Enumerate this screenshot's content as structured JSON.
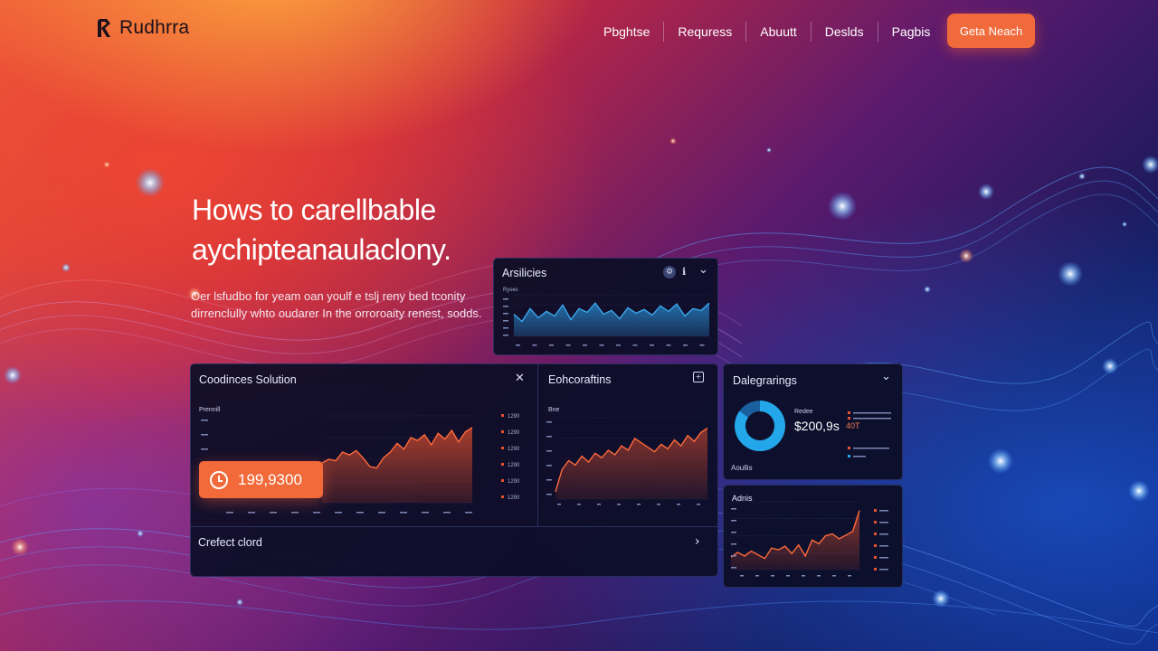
{
  "brand": {
    "name": "Rudhrra"
  },
  "nav": {
    "links": [
      "Pbghtse",
      "Requress",
      "Abuutt",
      "Deslds",
      "Pagbis"
    ],
    "cta": "Geta Neach"
  },
  "hero": {
    "title": "Hows to carellbable aychipteanaulaclony.",
    "subtitle": "Oer lsfudbo for yeam oan youlf e tslj reny bed tconity dirrenclully whto oudarer In the orroroaity renest, sodds."
  },
  "panels": {
    "analytics": {
      "title": "Arsilicies",
      "axis_label": "Ryses"
    },
    "solution": {
      "title": "Coodinces Solution",
      "axis_label": "Prennill",
      "metric": "199,9300",
      "legend": [
        "1290",
        "1290",
        "1290",
        "1290",
        "1290",
        "1290"
      ]
    },
    "conversions": {
      "title": "Eohcoraftins",
      "axis_label": "Bne"
    },
    "dalegrarings": {
      "title": "Dalegrarings",
      "label": "Redee",
      "value": "$200,9s",
      "delta": "40T",
      "sub": "Aoullis"
    },
    "admin": {
      "title": "Adnis"
    },
    "footer": {
      "label": "Crefect clord"
    }
  },
  "colors": {
    "accent": "#f06a3c",
    "chart_orange": "#e9522e",
    "chart_blue": "#2a8fd6",
    "panel_bg": "#0c0e26"
  },
  "chart_data": [
    {
      "type": "area",
      "title": "Arsilicies",
      "series": [
        {
          "values": [
            24,
            16,
            30,
            20,
            27,
            22,
            34,
            18,
            30,
            26,
            36,
            24,
            28,
            19,
            31,
            25,
            29,
            23,
            33,
            27,
            35,
            22,
            30,
            28,
            36
          ]
        }
      ],
      "ylim": [
        0,
        45
      ]
    },
    {
      "type": "area",
      "title": "Coodinces Solution",
      "series": [
        {
          "values": [
            55,
            60,
            58,
            70,
            66,
            72,
            62,
            50,
            48,
            62,
            70,
            82,
            74,
            90,
            86,
            94,
            80,
            96,
            88,
            100,
            84,
            98,
            104
          ]
        }
      ],
      "ylim": [
        0,
        120
      ]
    },
    {
      "type": "area",
      "title": "Eohcoraftins",
      "series": [
        {
          "values": [
            10,
            40,
            52,
            46,
            58,
            50,
            62,
            56,
            66,
            60,
            72,
            66,
            82,
            76,
            70,
            64,
            74,
            68,
            80,
            72,
            86,
            78,
            90,
            96
          ]
        }
      ],
      "ylim": [
        0,
        110
      ]
    },
    {
      "type": "pie",
      "title": "Dalegrarings",
      "values": [
        85,
        15
      ]
    },
    {
      "type": "area",
      "title": "Adnis",
      "series": [
        {
          "values": [
            20,
            28,
            22,
            30,
            24,
            18,
            35,
            32,
            38,
            26,
            40,
            22,
            48,
            42,
            55,
            58,
            50,
            56,
            62,
            96
          ]
        }
      ],
      "ylim": [
        0,
        110
      ]
    }
  ]
}
